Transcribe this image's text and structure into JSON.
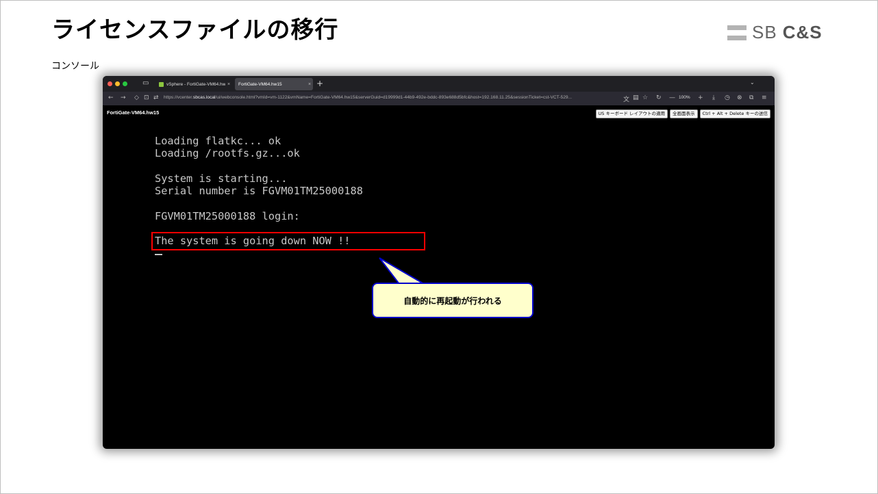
{
  "slide": {
    "title": "ライセンスファイルの移行",
    "subtitle": "コンソール",
    "logo": {
      "sb": "SB",
      "cs": "C&S"
    }
  },
  "browser": {
    "tabs": [
      {
        "label": "vSphere - FortiGate-VM64.hw15",
        "active": false
      },
      {
        "label": "FortiGate-VM64.hw15",
        "active": true
      }
    ],
    "url_prefix": "https://vcenter.",
    "url_host": "sbcas.local",
    "url_rest": "/ui/webconsole.html?vmId=vm-1122&vmName=FortiGate-VM64.hw15&serverGuid=d19999d1-44b9-492e-bddc-893e688d5bfc&host=192.168.11.25&sessionTicket=cst-VCT-529...",
    "zoom": "100%",
    "icons": {
      "close_tab": "×",
      "new_tab": "+",
      "tab_list": "⌄",
      "back": "←",
      "forward": "→",
      "reload": "↻",
      "zoom_out": "—",
      "zoom_in": "+",
      "menu": "≡"
    }
  },
  "console": {
    "vm_name": "FortiGate-VM64.hw15",
    "buttons": [
      "US キーボード レイアウトの適用",
      "全画面表示",
      "Ctrl + Alt + Delete キーの送信"
    ],
    "lines": [
      "Loading flatkc... ok",
      "Loading /rootfs.gz...ok",
      "",
      "System is starting...",
      "Serial number is FGVM01TM25000188",
      "",
      "FGVM01TM25000188 login:",
      "",
      "The system is going down NOW !!"
    ]
  },
  "callout": {
    "text": "自動的に再起動が行われる"
  },
  "colors": {
    "highlight": "#ff0000",
    "callout_fill": "#ffffcc",
    "callout_border": "#0000cc",
    "terminal_text": "#c8c8c8"
  }
}
